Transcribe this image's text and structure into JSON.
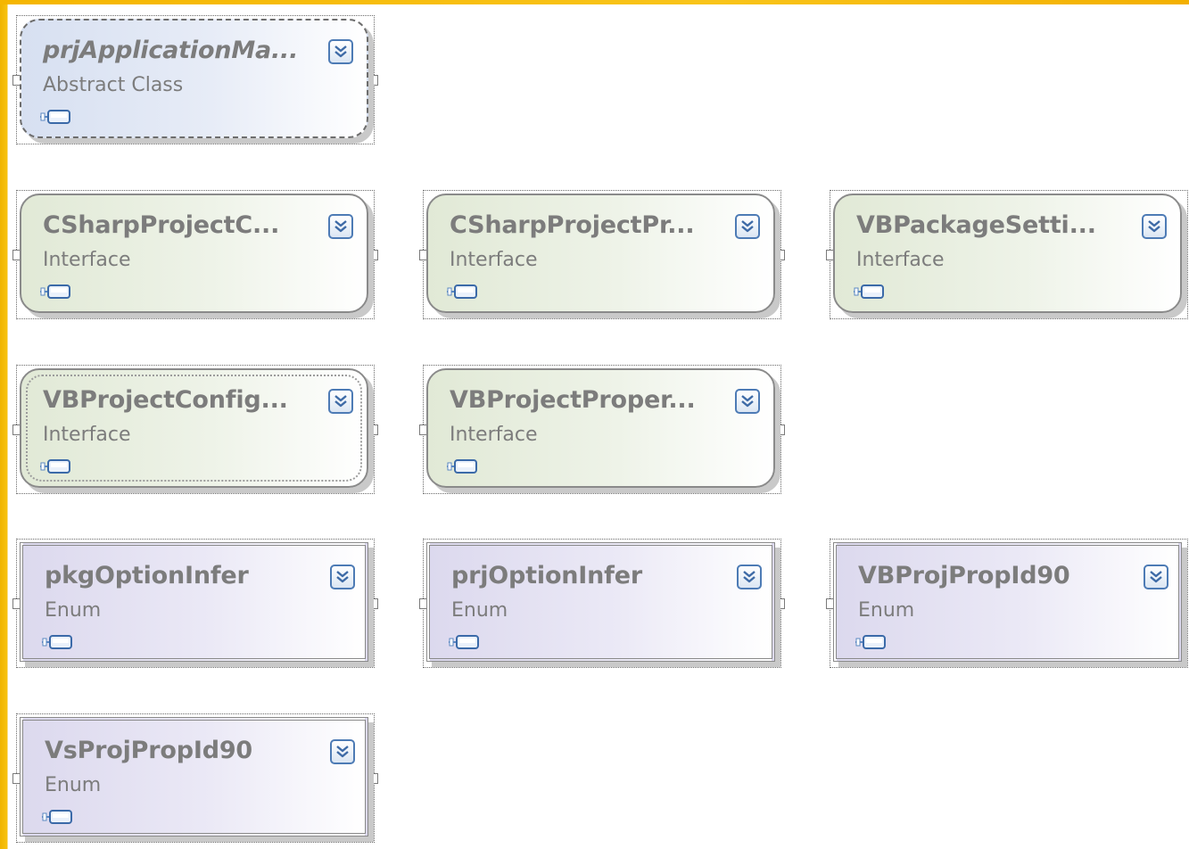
{
  "diagram": {
    "shapes": [
      {
        "id": "s1",
        "title": "prjApplicationMa...",
        "kind": "Abstract Class",
        "style": "abstract",
        "italic": true
      },
      {
        "id": "s2",
        "title": "CSharpProjectC...",
        "kind": "Interface",
        "style": "interface"
      },
      {
        "id": "s3",
        "title": "CSharpProjectPr...",
        "kind": "Interface",
        "style": "interface"
      },
      {
        "id": "s4",
        "title": "VBPackageSetti...",
        "kind": "Interface",
        "style": "interface"
      },
      {
        "id": "s5",
        "title": "VBProjectConfig...",
        "kind": "Interface",
        "style": "interface"
      },
      {
        "id": "s6",
        "title": "VBProjectProper...",
        "kind": "Interface",
        "style": "interface"
      },
      {
        "id": "s7",
        "title": "pkgOptionInfer",
        "kind": "Enum",
        "style": "enum"
      },
      {
        "id": "s8",
        "title": "prjOptionInfer",
        "kind": "Enum",
        "style": "enum"
      },
      {
        "id": "s9",
        "title": "VBProjPropId90",
        "kind": "Enum",
        "style": "enum"
      },
      {
        "id": "s10",
        "title": "VsProjPropId90",
        "kind": "Enum",
        "style": "enum"
      }
    ],
    "icons": {
      "expand": "double-chevron-down-icon",
      "lollipop": "interface-lollipop-icon"
    },
    "colors": {
      "abstract_fill": "#d7e0f1",
      "interface_fill": "#e1e9d6",
      "enum_fill": "#dcd9ee",
      "text": "#7c7c7c",
      "expander_border": "#4d7bb5",
      "frame_orange": "#f5b600"
    }
  }
}
